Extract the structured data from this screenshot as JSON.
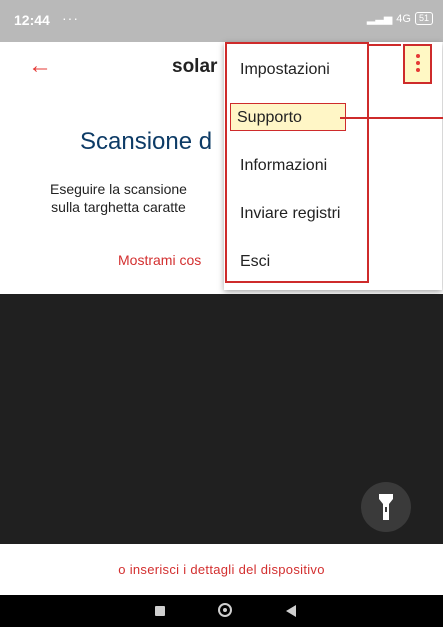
{
  "status_bar": {
    "time": "12:44",
    "indicators": "···",
    "network": "4G",
    "battery": "51"
  },
  "app_bar": {
    "title": "solar",
    "back_icon": "arrow-left-icon",
    "menu_icon": "more-vert-icon"
  },
  "content": {
    "heading": "Scansione d",
    "description_line1": "Eseguire la scansione",
    "description_line2": "sulla targhetta caratte",
    "show_me_link": "Mostrami cos"
  },
  "camera": {
    "flash_icon": "flashlight-icon"
  },
  "bottom": {
    "manual_entry_link": "o inserisci i dettagli del dispositivo"
  },
  "menu": {
    "items": [
      {
        "label": "Impostazioni"
      },
      {
        "label": "Supporto",
        "selected": true
      },
      {
        "label": "Informazioni"
      },
      {
        "label": "Inviare registri"
      },
      {
        "label": "Esci"
      }
    ]
  },
  "colors": {
    "accent": "#e53935",
    "heading": "#0d3b66",
    "annotation": "#ce2b2b",
    "highlight": "#fff6c6"
  }
}
